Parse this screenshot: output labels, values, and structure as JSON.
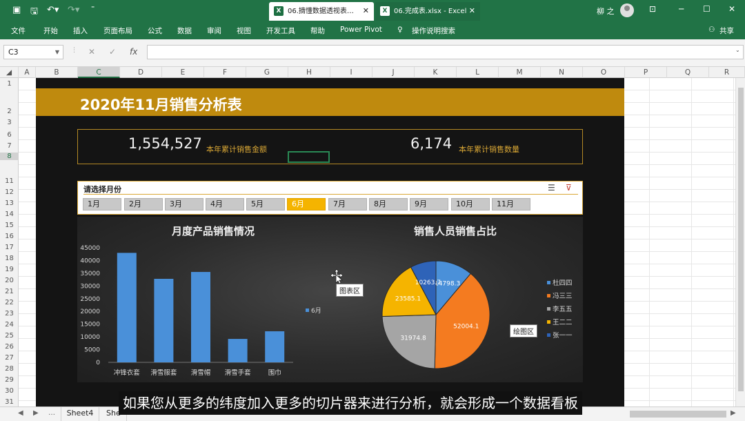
{
  "titlebar": {
    "tabs": [
      {
        "label": "06.摘懂数据透视表…",
        "close": "✕"
      },
      {
        "label": "06.完成表.xlsx - Excel",
        "close": "✕"
      }
    ],
    "user": "柳 之",
    "app_color": "#217346"
  },
  "ribbon": {
    "menu": [
      "文件",
      "开始",
      "插入",
      "页面布局",
      "公式",
      "数据",
      "审阅",
      "视图",
      "开发工具",
      "帮助",
      "Power Pivot"
    ],
    "search": "操作说明搜索",
    "share": "共享"
  },
  "formula_bar": {
    "name_box": "C3",
    "value": ""
  },
  "sheet": {
    "columns": [
      "A",
      "B",
      "C",
      "D",
      "E",
      "F",
      "G",
      "H",
      "I",
      "J",
      "K",
      "L",
      "M",
      "N",
      "O",
      "P",
      "Q",
      "R"
    ],
    "rows": [
      "1",
      "2",
      "3",
      "6",
      "7",
      "8",
      "11",
      "12",
      "13",
      "14",
      "15",
      "16",
      "17",
      "18",
      "19",
      "20",
      "21",
      "22",
      "23",
      "24",
      "25",
      "26",
      "27",
      "28",
      "29",
      "30",
      "31"
    ],
    "tabs": [
      "Sheet4",
      "She"
    ]
  },
  "dashboard": {
    "title": "2020年11月销售分析表",
    "kpi1": {
      "value": "1,554,527",
      "label": "本年累计销售金额"
    },
    "kpi2": {
      "value": "6,174",
      "label": "本年累计销售数量"
    },
    "accent_color": "#bf8a0e",
    "slicer": {
      "title": "请选择月份",
      "items": [
        "1月",
        "2月",
        "3月",
        "4月",
        "5月",
        "6月",
        "7月",
        "8月",
        "9月",
        "10月",
        "11月"
      ],
      "selected": "6月",
      "selected_color": "#f5b400"
    }
  },
  "chart_data": [
    {
      "type": "bar",
      "title": "月度产品销售情况",
      "categories": [
        "冲锋衣套",
        "滑雪服套",
        "滑雪帽",
        "滑雪手套",
        "围巾"
      ],
      "series": [
        {
          "name": "6月",
          "values": [
            43000,
            32800,
            35500,
            9200,
            12200
          ],
          "color": "#4a90d9"
        }
      ],
      "yticks": [
        "0",
        "5000",
        "10000",
        "15000",
        "20000",
        "25000",
        "30000",
        "35000",
        "40000",
        "45000"
      ],
      "ylim": [
        0,
        45000
      ]
    },
    {
      "type": "pie",
      "title": "销售人员销售占比",
      "slices": [
        {
          "name": "杜四四",
          "label": "14798.3",
          "value": 14798.3,
          "color": "#4a90d9"
        },
        {
          "name": "冯三三",
          "label": "52004.1",
          "value": 52004.1,
          "color": "#f47b20"
        },
        {
          "name": "李五五",
          "label": "31974.8",
          "value": 31974.8,
          "color": "#a5a5a5"
        },
        {
          "name": "王二二",
          "label": "23585.1",
          "value": 23585.1,
          "color": "#f5b400"
        },
        {
          "name": "张一一",
          "label": "10263.7",
          "value": 10263.7,
          "color": "#2e63b8"
        }
      ]
    }
  ],
  "tooltips": {
    "chart_area": "图表区",
    "plot_area": "绘图区"
  },
  "subtitle": "如果您从更多的纬度加入更多的切片器来进行分析，就会形成一个数据看板"
}
